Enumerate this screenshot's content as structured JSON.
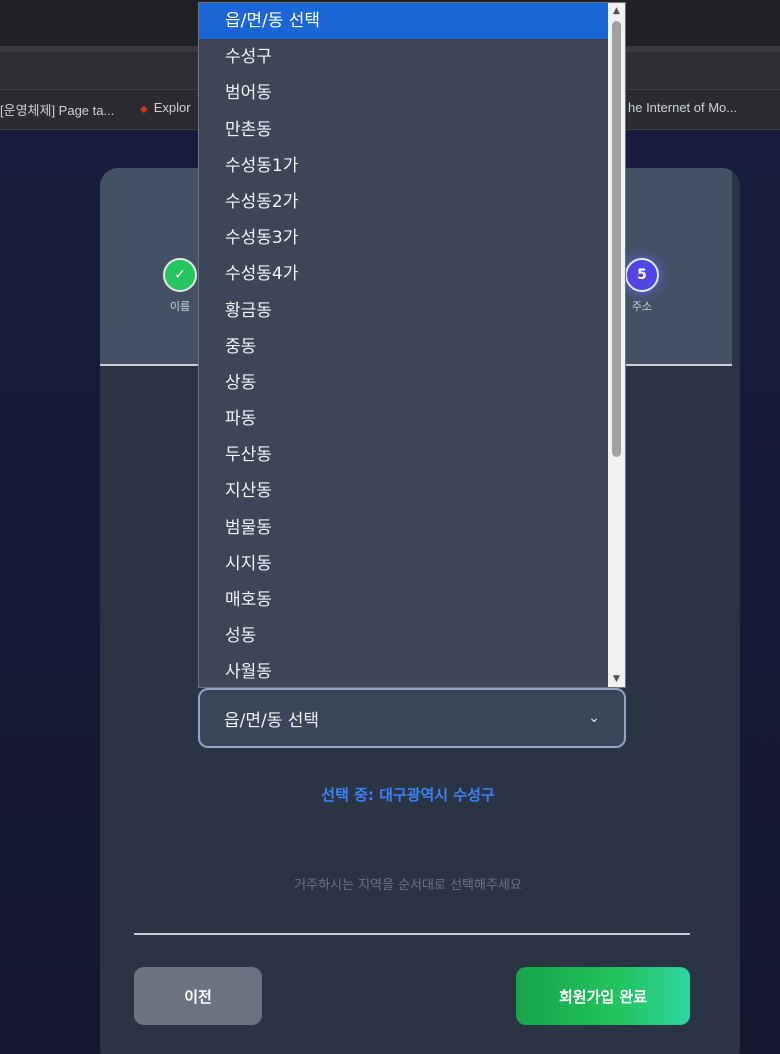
{
  "browser": {
    "bookmarks": [
      {
        "label": "[운영체제] Page ta..."
      },
      {
        "label": "Explor"
      },
      {
        "label": "he Internet of Mo..."
      }
    ]
  },
  "stepper": {
    "steps": [
      {
        "icon": "check-icon",
        "label": "이름",
        "status": "done"
      },
      {
        "number": "5",
        "label": "주소",
        "status": "active"
      }
    ]
  },
  "dropdown": {
    "options": [
      "읍/면/동 선택",
      "수성구",
      "범어동",
      "만촌동",
      "수성동1가",
      "수성동2가",
      "수성동3가",
      "수성동4가",
      "황금동",
      "중동",
      "상동",
      "파동",
      "두산동",
      "지산동",
      "범물동",
      "시지동",
      "매호동",
      "성동",
      "사월동"
    ],
    "highlighted_index": 0
  },
  "form": {
    "select_value": "읍/면/동 선택",
    "selected_info": "선택 중: 대구광역시 수성구",
    "hint": "거주하시는 지역을 순서대로 선택해주세요"
  },
  "buttons": {
    "prev_label": "이전",
    "complete_label": "회원가입 완료"
  },
  "colors": {
    "highlight": "#1a66d6",
    "accent_blue": "#3b82f6",
    "success_green": "#22c55e",
    "step_active": "#4f46e5"
  }
}
